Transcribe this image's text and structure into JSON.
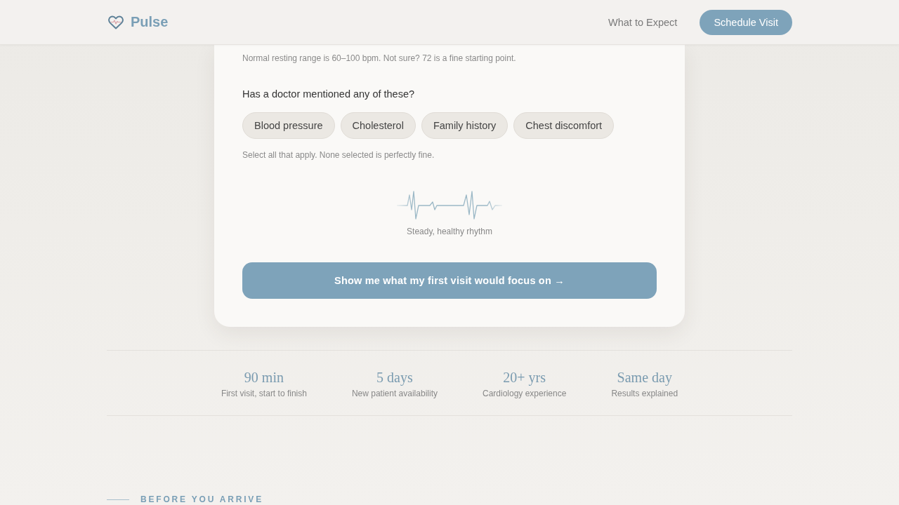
{
  "header": {
    "brand": "Pulse",
    "nav_link": "What to Expect",
    "cta": "Schedule Visit"
  },
  "card": {
    "heart_rate_hint": "Normal resting range is 60–100 bpm. Not sure? 72 is a fine starting point.",
    "question": "Has a doctor mentioned any of these?",
    "options": [
      {
        "label": "Blood pressure",
        "selected": false
      },
      {
        "label": "Cholesterol",
        "selected": false
      },
      {
        "label": "Family history",
        "selected": false
      },
      {
        "label": "Chest discomfort",
        "selected": false
      }
    ],
    "options_note": "Select all that apply. None selected is perfectly fine.",
    "rhythm_caption": "Steady, healthy rhythm",
    "submit": "Show me what my first visit would focus on →"
  },
  "stats": [
    {
      "value": "90 min",
      "label": "First visit, start to finish"
    },
    {
      "value": "5 days",
      "label": "New patient availability"
    },
    {
      "value": "20+ yrs",
      "label": "Cardiology experience"
    },
    {
      "value": "Same day",
      "label": "Results explained"
    }
  ],
  "next_section": {
    "eyebrow": "BEFORE YOU ARRIVE"
  }
}
